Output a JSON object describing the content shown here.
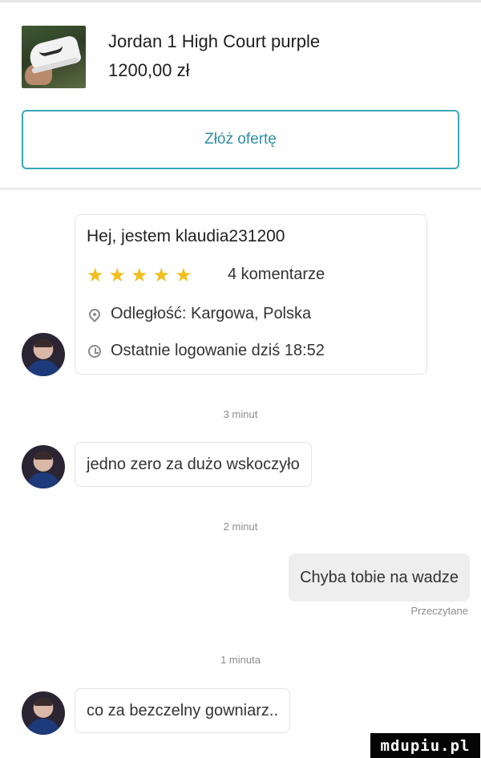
{
  "listing": {
    "title": "Jordan 1 High Court purple",
    "price": "1200,00 zł",
    "thumbnail": "sneaker-photo"
  },
  "offer_button": {
    "label": "Złóż ofertę"
  },
  "profile": {
    "greeting": "Hej, jestem klaudia231200",
    "rating_stars": 5,
    "rating_max": 5,
    "comments": "4 komentarze",
    "location": "Odległość: Kargowa, Polska",
    "last_login": "Ostatnie logowanie dziś 18:52"
  },
  "messages": [
    {
      "time": "3 minut",
      "text": "jedno zero za dużo wskoczyło",
      "side": "in"
    },
    {
      "time": "2 minut",
      "text": "Chyba tobie na wadze",
      "side": "out",
      "status": "Przeczytane"
    },
    {
      "time": "1 minuta",
      "text": "co za bezczelny gowniarz..",
      "side": "in"
    }
  ],
  "watermark": "mdupiu.pl",
  "colors": {
    "accent": "#3aa7b8",
    "star": "#f2bf20"
  }
}
